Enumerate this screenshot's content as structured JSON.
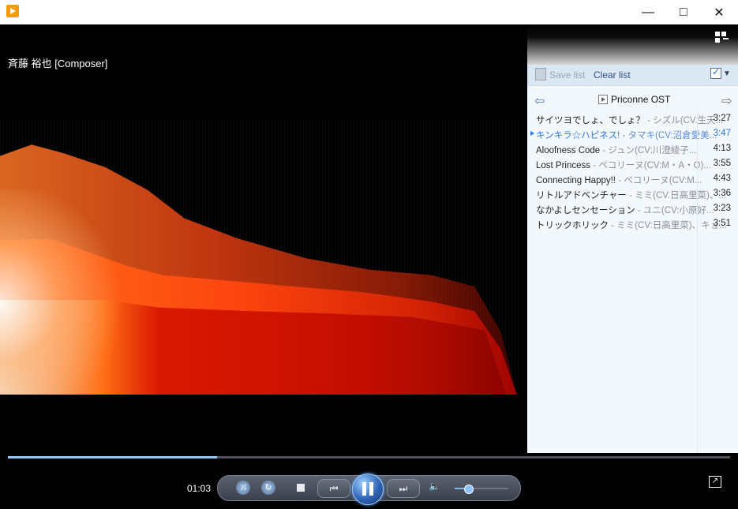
{
  "window": {
    "app_icon": "media-player-icon",
    "buttons": {
      "minimize": "—",
      "maximize": "□",
      "close": "✕"
    }
  },
  "video": {
    "now_playing": "斉藤 裕也 [Composer]"
  },
  "panel": {
    "toolbar": {
      "save_label": "Save list",
      "clear_label": "Clear list"
    },
    "playlist_title": "Priconne OST",
    "tracks": [
      {
        "title": "サイツヨでしょ、でしょ？",
        "artist": " - シズル(CV.生天...",
        "duration": "3:27"
      },
      {
        "title": "キンキラ☆ハピネス!",
        "artist": " - タマキ(CV:沼倉愛美...",
        "duration": "3:47"
      },
      {
        "title": "Aloofness Code",
        "artist": " - ジュン(CV:川澄綾子...",
        "duration": "4:13"
      },
      {
        "title": "Lost Princess",
        "artist": " - ペコリーヌ(CV:M・A・O)...",
        "duration": "3:55"
      },
      {
        "title": "Connecting Happy!!",
        "artist": " - ペコリーヌ(CV:M...",
        "duration": "4:43"
      },
      {
        "title": "リトルアドベンチャー",
        "artist": " - ミミ(CV.日高里菜)、...",
        "duration": "3:36"
      },
      {
        "title": "なかよしセンセーション",
        "artist": " - ユニ(CV:小原好...",
        "duration": "3:23"
      },
      {
        "title": "トリックホリック",
        "artist": " - ミミ(CV:日高里菜)、キョ...",
        "duration": "3:51"
      }
    ]
  },
  "controls": {
    "elapsed": "01:03",
    "progress": 0.29,
    "volume": 0.22,
    "icons": [
      "shuffle-icon",
      "repeat-icon",
      "stop-icon",
      "previous-icon",
      "pause-icon",
      "next-icon",
      "volume-icon",
      "fullscreen-icon"
    ]
  }
}
